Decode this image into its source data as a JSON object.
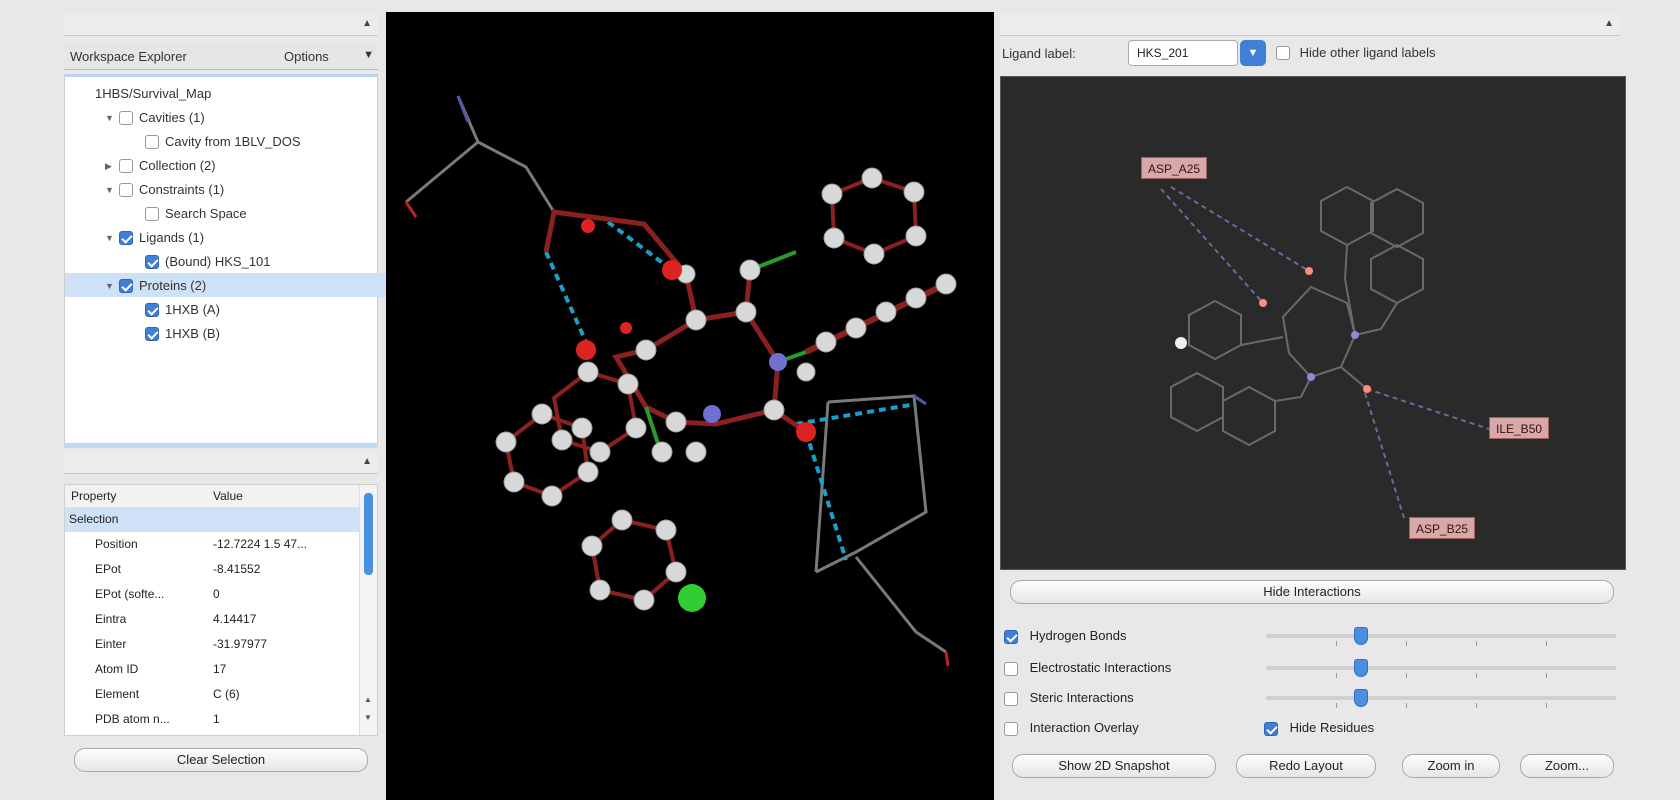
{
  "explorer": {
    "title": "Workspace Explorer",
    "options_label": "Options",
    "tree": [
      {
        "label": "1HBS/Survival_Map",
        "indent": 0,
        "toggle": "",
        "checkbox": "none"
      },
      {
        "label": "Cavities (1)",
        "indent": 1,
        "toggle": "▼",
        "checkbox": "off"
      },
      {
        "label": "Cavity from 1BLV_DOS",
        "indent": 2,
        "toggle": "",
        "checkbox": "off"
      },
      {
        "label": "Collection (2)",
        "indent": 1,
        "toggle": "▶",
        "checkbox": "off"
      },
      {
        "label": "Constraints (1)",
        "indent": 1,
        "toggle": "▼",
        "checkbox": "off"
      },
      {
        "label": "Search Space",
        "indent": 2,
        "toggle": "",
        "checkbox": "off"
      },
      {
        "label": "Ligands (1)",
        "indent": 1,
        "toggle": "▼",
        "checkbox": "on"
      },
      {
        "label": "(Bound) HKS_101",
        "indent": 2,
        "toggle": "",
        "checkbox": "on"
      },
      {
        "label": "Proteins (2)",
        "indent": 1,
        "toggle": "▼",
        "checkbox": "on",
        "selected": true
      },
      {
        "label": "1HXB (A)",
        "indent": 2,
        "toggle": "",
        "checkbox": "on"
      },
      {
        "label": "1HXB (B)",
        "indent": 2,
        "toggle": "",
        "checkbox": "on"
      }
    ]
  },
  "properties": {
    "headers": [
      "Property",
      "Value"
    ],
    "section": "Selection",
    "rows": [
      {
        "key": "Position",
        "value": "-12.7224 1.5 47..."
      },
      {
        "key": "EPot",
        "value": "-8.41552"
      },
      {
        "key": "EPot (softe...",
        "value": "0"
      },
      {
        "key": "Eintra",
        "value": "4.14417"
      },
      {
        "key": "Einter",
        "value": "-31.97977"
      },
      {
        "key": "Atom ID",
        "value": "17"
      },
      {
        "key": "Element",
        "value": "C (6)"
      },
      {
        "key": "PDB atom n...",
        "value": "1"
      }
    ],
    "clear_button": "Clear Selection"
  },
  "ligand_panel": {
    "ligand_label": "Ligand label:",
    "ligand_value": "HKS_201",
    "hide_other_label": "Hide other ligand labels",
    "residue_labels": [
      "ASP_A25",
      "ILE_B50",
      "ASP_B25"
    ],
    "hide_interactions_button": "Hide Interactions",
    "toggles": [
      {
        "label": "Hydrogen Bonds",
        "checked": true,
        "slider": 0.6
      },
      {
        "label": "Electrostatic Interactions",
        "checked": false,
        "slider": 0.6
      },
      {
        "label": "Steric Interactions",
        "checked": false,
        "slider": 0.6
      },
      {
        "label": "Interaction Overlay",
        "checked": false
      }
    ],
    "hide_residues_label": "Hide Residues",
    "hide_residues_checked": true,
    "buttons": [
      "Show 2D Snapshot",
      "Redo Layout",
      "Zoom in",
      "Zoom..."
    ]
  },
  "colors": {
    "selection": "#cfe1f7",
    "accent": "#3f7fd8",
    "viewer_bg": "#000000",
    "diagram_bg": "#2a2a2a"
  }
}
